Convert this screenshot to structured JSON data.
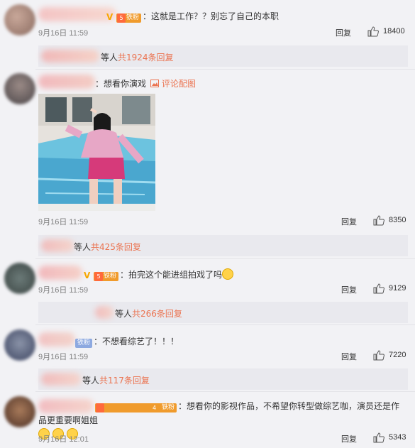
{
  "comments": [
    {
      "text": "：这就是工作？？别忘了自己的本职",
      "time": "9月16日 11:59",
      "reply_label": "回复",
      "likes": "18400",
      "fan_badge": "铁粉",
      "fan_level": "5",
      "sub_text": "等人",
      "sub_count": "共1924条回复"
    },
    {
      "text": "：想看你演戏",
      "image_comment": "评论配图",
      "time": "9月16日 11:59",
      "reply_label": "回复",
      "likes": "8350",
      "sub_text": "等人",
      "sub_count": "共425条回复"
    },
    {
      "text": "：拍完这个能进组拍戏了吗",
      "time": "9月16日 11:59",
      "reply_label": "回复",
      "likes": "9129",
      "fan_badge": "铁粉",
      "fan_level": "5",
      "sub_text": "等人",
      "sub_count": "共266条回复"
    },
    {
      "text": "：不想看综艺了！！！",
      "time": "9月16日 11:59",
      "reply_label": "回复",
      "likes": "7220",
      "fan_badge": "铁粉",
      "sub_text": "等人",
      "sub_count": "共117条回复"
    },
    {
      "text": "：想看你的影视作品，不希望你转型做综艺咖，演员还是作品更重要啊姐姐",
      "time": "9月16日 12:01",
      "reply_label": "回复",
      "likes": "5343",
      "fan_badge": "铁粉",
      "fan_level": "4"
    }
  ],
  "colors": {
    "background": "#f2f2f5",
    "link_orange": "#eb7350",
    "fan_badge": "#f09b2c",
    "time_gray": "#808080"
  }
}
